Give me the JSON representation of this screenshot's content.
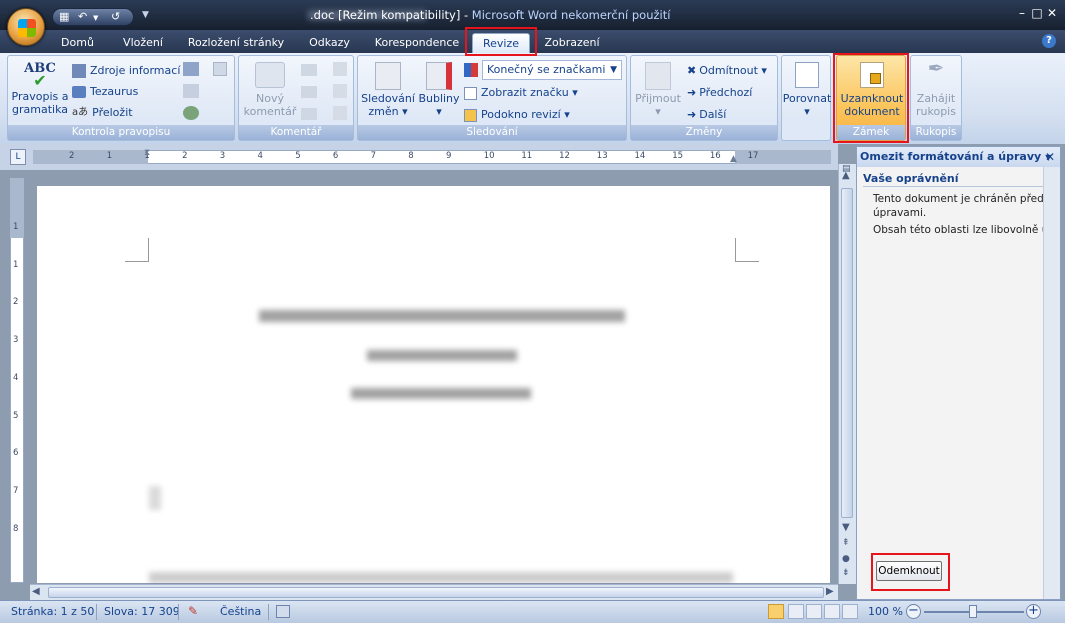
{
  "window": {
    "title_doc_suffix": ".doc [Režim kompatibility]",
    "title_separator": " - ",
    "title_app": "Microsoft Word nekomerční použití",
    "minimize": "–",
    "maximize": "□",
    "close": "✕"
  },
  "tabs": [
    {
      "label": "Domů"
    },
    {
      "label": "Vložení"
    },
    {
      "label": "Rozložení stránky"
    },
    {
      "label": "Odkazy"
    },
    {
      "label": "Korespondence"
    },
    {
      "label": "Revize"
    },
    {
      "label": "Zobrazení"
    }
  ],
  "ribbon": {
    "kontrola": {
      "label": "Kontrola pravopisu",
      "spell_line1": "Pravopis a",
      "spell_line2": "gramatika",
      "spell_icon": "ABC",
      "research": "Zdroje informací",
      "thesaurus": "Tezaurus",
      "translate": "Přeložit"
    },
    "komentar": {
      "label": "Komentář",
      "new_line1": "Nový",
      "new_line2": "komentář"
    },
    "sledovani": {
      "label": "Sledování",
      "track_line1": "Sledování",
      "track_line2": "změn",
      "balloons": "Bubliny",
      "display_select": "Konečný se značkami",
      "show_markup": "Zobrazit značku",
      "review_pane": "Podokno revizí"
    },
    "zmeny": {
      "label": "Změny",
      "accept": "Přijmout",
      "reject": "Odmítnout",
      "previous": "Předchozí",
      "next": "Další"
    },
    "porovnat": {
      "label": "Porovnat"
    },
    "zamek": {
      "label": "Zámek",
      "lock_line1": "Uzamknout",
      "lock_line2": "dokument"
    },
    "rukopis": {
      "label": "Rukopis",
      "ink_line1": "Zahájit",
      "ink_line2": "rukopis"
    }
  },
  "ruler": {
    "numbers": [
      "2",
      "1",
      "1",
      "2",
      "3",
      "4",
      "5",
      "6",
      "7",
      "8",
      "9",
      "10",
      "11",
      "12",
      "13",
      "14",
      "15",
      "16",
      "17"
    ],
    "vnumbers": [
      "1",
      "1",
      "2",
      "3",
      "4",
      "5",
      "6",
      "7",
      "8"
    ]
  },
  "pane": {
    "title": "Omezit formátování a úpravy",
    "section": "Vaše oprávnění",
    "text1": "Tento dokument je chráněn před neúm",
    "text1b": "úpravami.",
    "text2": "Obsah této oblasti lze libovolně upravo",
    "unprotect": "Odemknout"
  },
  "status": {
    "page": "Stránka: 1 z 50",
    "words": "Slova: 17 309",
    "language": "Čeština",
    "zoom": "100 %"
  }
}
